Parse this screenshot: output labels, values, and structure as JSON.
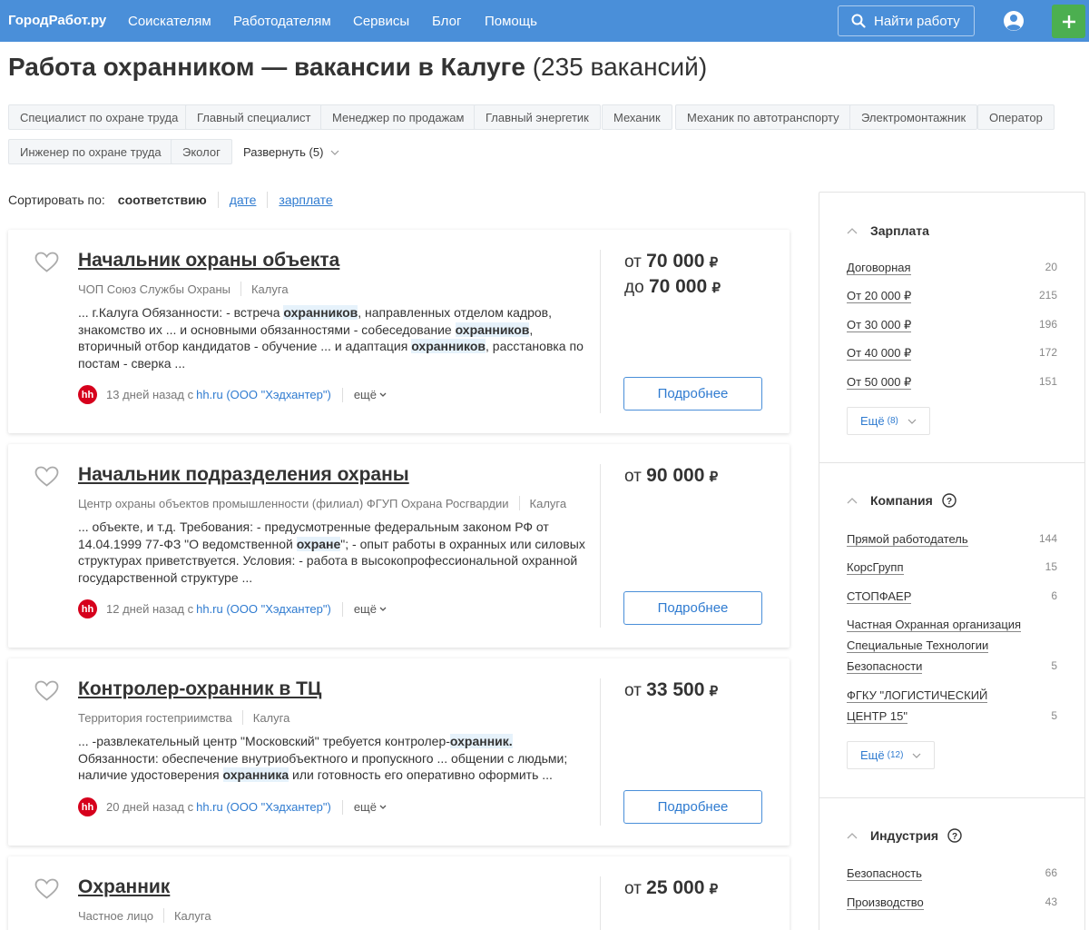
{
  "header": {
    "logo": "ГородРабот.ру",
    "nav": [
      "Соискателям",
      "Работодателям",
      "Сервисы",
      "Блог",
      "Помощь"
    ],
    "find_button": "Найти работу"
  },
  "page": {
    "title": "Работа охранником — вакансии в Калуге",
    "count": "(235 вакансий)"
  },
  "tags": [
    "Специалист по охране труда",
    "Главный специалист",
    "Менеджер по продажам",
    "Главный энергетик",
    "Механик",
    "Механик по автотранспорту",
    "Электромонтажник",
    "Оператор",
    "Инженер по охране труда",
    "Эколог"
  ],
  "expand_label": "Развернуть (5)",
  "sort": {
    "label": "Сортировать по:",
    "active": "соответствию",
    "options": [
      "дате",
      "зарплате"
    ]
  },
  "vacancies": [
    {
      "title": "Начальник охраны объекта",
      "company": "ЧОП Союз Службы Охраны",
      "city": "Калуга",
      "snippet": [
        {
          "t": "... г.Калуга Обязанности: - встреча "
        },
        {
          "t": "охранников",
          "hl": true
        },
        {
          "t": ", направленных отделом кадров, знакомство их ... и основными обязанностями - собеседование "
        },
        {
          "t": "охранников",
          "hl": true
        },
        {
          "t": ", вторичный отбор кандидатов - обучение ... и адаптация "
        },
        {
          "t": "охранников",
          "hl": true
        },
        {
          "t": ", расстановка по постам - сверка ..."
        }
      ],
      "source_text": "13 дней назад с",
      "source_link": "hh.ru (ООО \"Хэдхантер\")",
      "more": "ещё",
      "salary_from": "70 000",
      "salary_to": "70 000",
      "details_button": "Подробнее"
    },
    {
      "title": "Начальник подразделения охраны",
      "company": "Центр охраны объектов промышленности (филиал) ФГУП Охрана Росгвардии",
      "city": "Калуга",
      "snippet": [
        {
          "t": "... объекте, и т.д. Требования: - предусмотренные федеральным законом РФ от 14.04.1999 77-ФЗ \"О ведомственной "
        },
        {
          "t": "охране",
          "hl": true
        },
        {
          "t": "\"; - опыт работы в охранных или силовых структурах приветствуется. Условия: - работа в высокопрофессиональной охранной государственной структуре ..."
        }
      ],
      "source_text": "12 дней назад с",
      "source_link": "hh.ru (ООО \"Хэдхантер\")",
      "more": "ещё",
      "salary_from": "90 000",
      "details_button": "Подробнее"
    },
    {
      "title": "Контролер-охранник в ТЦ",
      "company": "Территория гостеприимства",
      "city": "Калуга",
      "snippet": [
        {
          "t": "... -развлекательный центр \"Московский\" требуется контролер-"
        },
        {
          "t": "охранник.",
          "hl": true
        },
        {
          "t": " Обязанности: обеспечение внутриобъектного и пропускного ... общении с людьми; наличие удостоверения "
        },
        {
          "t": "охранника",
          "hl": true
        },
        {
          "t": " или готовность его оперативно оформить ..."
        }
      ],
      "source_text": "20 дней назад с",
      "source_link": "hh.ru (ООО \"Хэдхантер\")",
      "more": "ещё",
      "salary_from": "33 500",
      "details_button": "Подробнее"
    },
    {
      "title": "Охранник",
      "company": "Частное лицо",
      "city": "Калуга",
      "salary_from": "25 000"
    }
  ],
  "salary_prefix_from": "от",
  "salary_prefix_to": "до",
  "currency": "₽",
  "filters": {
    "salary": {
      "title": "Зарплата",
      "items": [
        {
          "label": "Договорная",
          "count": "20"
        },
        {
          "label": "От 20 000 ₽",
          "count": "215"
        },
        {
          "label": "От 30 000 ₽",
          "count": "196"
        },
        {
          "label": "От 40 000 ₽",
          "count": "172"
        },
        {
          "label": "От 50 000 ₽",
          "count": "151"
        }
      ],
      "more": "Ещё",
      "more_count": "(8)"
    },
    "company": {
      "title": "Компания",
      "items": [
        {
          "label": "Прямой работодатель",
          "count": "144"
        },
        {
          "label": "КорсГрупп",
          "count": "15"
        },
        {
          "label": "СТОПФАЕР",
          "count": "6"
        },
        {
          "label": "Частная Охранная организация Специальные Технологии Безопасности",
          "count": "5"
        },
        {
          "label": "ФГКУ \"ЛОГИСТИЧЕСКИЙ ЦЕНТР 15\"",
          "count": "5"
        }
      ],
      "more": "Ещё",
      "more_count": "(12)"
    },
    "industry": {
      "title": "Индустрия",
      "items": [
        {
          "label": "Безопасность",
          "count": "66"
        },
        {
          "label": "Производство",
          "count": "43"
        }
      ]
    }
  }
}
